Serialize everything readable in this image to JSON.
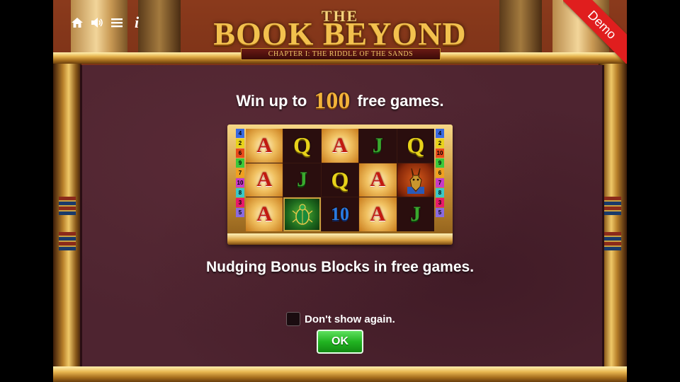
{
  "game": {
    "logo_the": "THE",
    "logo_title": "BOOK BEYOND",
    "logo_subtitle": "CHAPTER I: THE RIDDLE OF THE SANDS"
  },
  "toolbar": {
    "home_icon": "home-icon",
    "sound_icon": "speaker-icon",
    "menu_icon": "menu-icon",
    "info_label": "i"
  },
  "ribbon": {
    "label": "Demo",
    "color": "#e01e1e"
  },
  "popup": {
    "headline_pre": "Win up to",
    "headline_number": "100",
    "headline_post": "free games.",
    "feature_text": "Nudging Bonus Blocks in free games.",
    "dont_show_label": "Don't show again.",
    "dont_show_checked": false,
    "ok_label": "OK"
  },
  "reels": {
    "paylines_left": [
      "4",
      "2",
      "6",
      "9",
      "7",
      "10",
      "8",
      "3",
      "5"
    ],
    "paylines_right": [
      "4",
      "2",
      "10",
      "9",
      "6",
      "7",
      "8",
      "3",
      "5"
    ],
    "payline_colors": [
      "#3a6ae0",
      "#e8d21a",
      "#e84a1a",
      "#3ac83a",
      "#f0a020",
      "#c83ac8",
      "#3ac8c8",
      "#e81a6a",
      "#8a6ae0"
    ],
    "symbols": [
      [
        "A",
        "Q",
        "A",
        "J",
        "Q"
      ],
      [
        "A",
        "J",
        "Q",
        "A",
        "Anubis"
      ],
      [
        "A",
        "Scarab",
        "10",
        "A",
        "J"
      ]
    ]
  },
  "colors": {
    "accent_gold": "#f2b23a",
    "ok_green": "#22b422",
    "panel_bg": "#4e2430"
  }
}
